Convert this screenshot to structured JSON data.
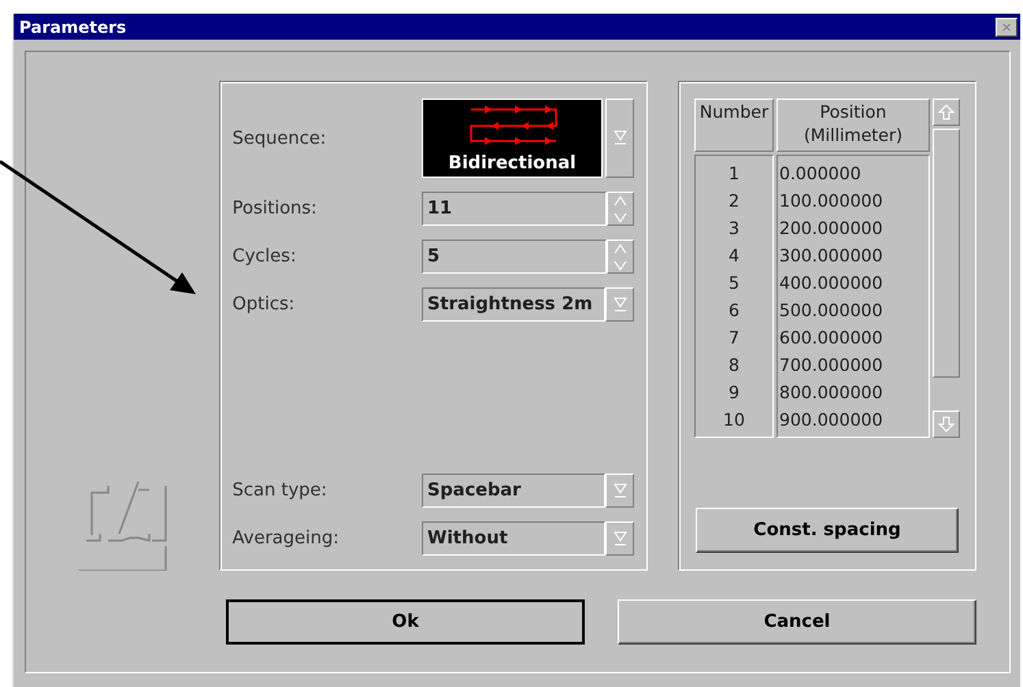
{
  "window": {
    "title": "Parameters",
    "close": "×"
  },
  "fields": [
    {
      "kind": "sequence",
      "label": "Sequence:",
      "value": "Bidirectional"
    },
    {
      "kind": "spinner",
      "label": "Positions:",
      "value": "11"
    },
    {
      "kind": "spinner",
      "label": "Cycles:",
      "value": "5"
    },
    {
      "kind": "dropdown",
      "label": "Optics:",
      "value": "Straightness 2m"
    },
    {
      "kind": "gap"
    },
    {
      "kind": "dropdown",
      "label": "Scan type:",
      "value": "Spacebar"
    },
    {
      "kind": "dropdown",
      "label": "Averageing:",
      "value": "Without"
    }
  ],
  "table": {
    "columns": [
      "Number",
      "Position\n(Millimeter)"
    ],
    "rows": [
      [
        "1",
        "0.000000"
      ],
      [
        "2",
        "100.000000"
      ],
      [
        "3",
        "200.000000"
      ],
      [
        "4",
        "300.000000"
      ],
      [
        "5",
        "400.000000"
      ],
      [
        "6",
        "500.000000"
      ],
      [
        "7",
        "600.000000"
      ],
      [
        "8",
        "700.000000"
      ],
      [
        "9",
        "800.000000"
      ],
      [
        "10",
        "900.000000"
      ]
    ]
  },
  "spacing_button": "Const. spacing",
  "buttons": [
    {
      "label": "Ok",
      "default": true
    },
    {
      "label": "Cancel",
      "default": false
    }
  ]
}
